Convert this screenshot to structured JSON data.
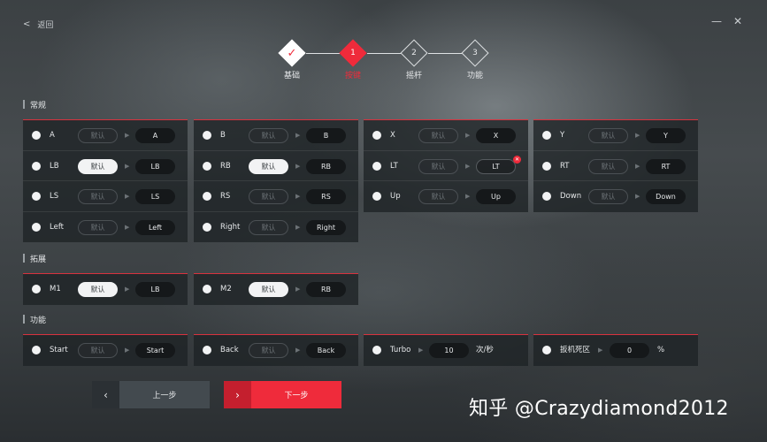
{
  "header": {
    "back_label": "返回",
    "back_icon": "chevron-left-icon",
    "minimize_icon": "minimize-icon",
    "close_icon": "close-icon"
  },
  "stepper": {
    "steps": [
      {
        "num": "✓",
        "label": "基础",
        "state": "done"
      },
      {
        "num": "1",
        "label": "按键",
        "state": "active"
      },
      {
        "num": "2",
        "label": "摇杆",
        "state": "pending"
      },
      {
        "num": "3",
        "label": "功能",
        "state": "pending"
      }
    ]
  },
  "sections": {
    "regular": "常规",
    "extended": "拓展",
    "functions": "功能"
  },
  "default_label": "默认",
  "regular_panels": [
    {
      "rows": [
        {
          "key": "A",
          "default_on": false,
          "map": "A"
        },
        {
          "key": "LB",
          "default_on": true,
          "map": "LB"
        },
        {
          "key": "LS",
          "default_on": false,
          "map": "LS"
        },
        {
          "key": "Left",
          "default_on": false,
          "map": "Left"
        }
      ]
    },
    {
      "rows": [
        {
          "key": "B",
          "default_on": false,
          "map": "B"
        },
        {
          "key": "RB",
          "default_on": true,
          "map": "RB"
        },
        {
          "key": "RS",
          "default_on": false,
          "map": "RS"
        },
        {
          "key": "Right",
          "default_on": false,
          "map": "Right"
        }
      ]
    },
    {
      "rows": [
        {
          "key": "X",
          "default_on": false,
          "map": "X"
        },
        {
          "key": "LT",
          "default_on": false,
          "map": "LT",
          "error": true
        },
        {
          "key": "Up",
          "default_on": false,
          "map": "Up"
        }
      ]
    },
    {
      "rows": [
        {
          "key": "Y",
          "default_on": false,
          "map": "Y"
        },
        {
          "key": "RT",
          "default_on": false,
          "map": "RT"
        },
        {
          "key": "Down",
          "default_on": false,
          "map": "Down"
        }
      ]
    }
  ],
  "extended_panels": [
    {
      "key": "M1",
      "default_on": true,
      "map": "LB"
    },
    {
      "key": "M2",
      "default_on": true,
      "map": "RB"
    }
  ],
  "function_panels": {
    "start": {
      "key": "Start",
      "map": "Start"
    },
    "back": {
      "key": "Back",
      "map": "Back"
    },
    "turbo": {
      "key": "Turbo",
      "value": "10",
      "unit": "次/秒"
    },
    "deadzone": {
      "key": "扳机死区",
      "value": "0",
      "unit": "%"
    }
  },
  "footer": {
    "prev_label": "上一步",
    "next_label": "下一步"
  },
  "watermark": "知乎 @Crazydiamond2012",
  "colors": {
    "accent": "#ef2b3b",
    "panel": "#1e2225",
    "pill_dark": "#15181a"
  }
}
